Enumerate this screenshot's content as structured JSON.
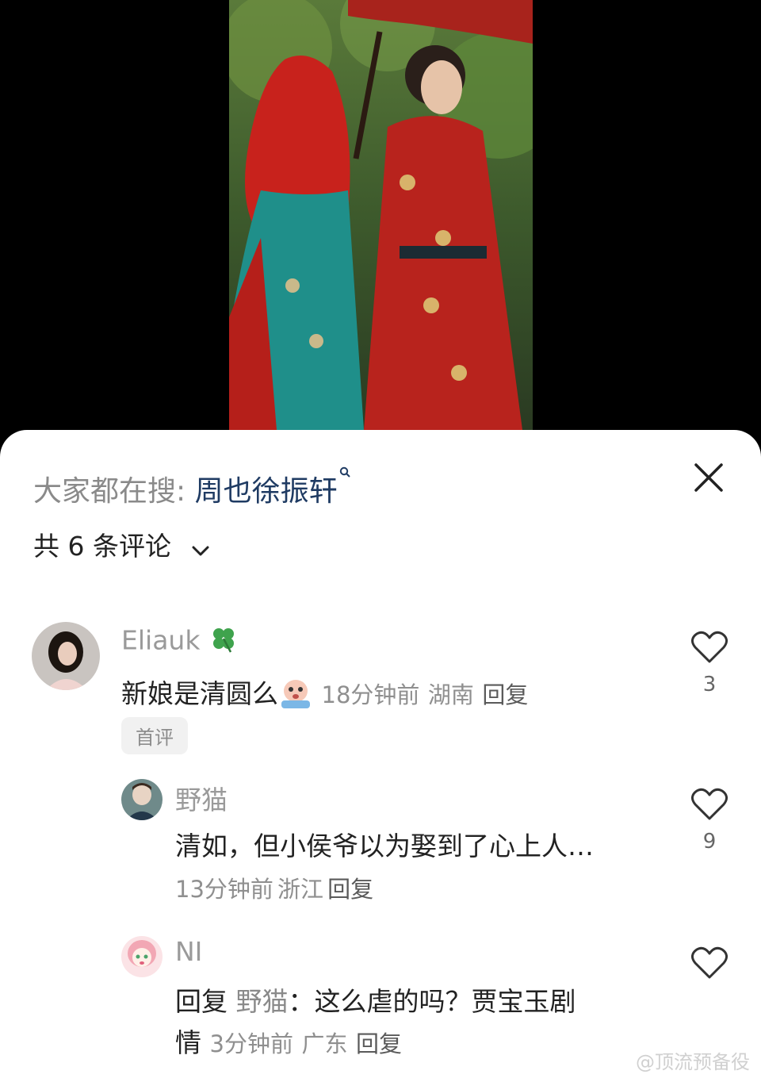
{
  "search": {
    "prefix": "大家都在搜",
    "separator": ":",
    "term": "周也徐振轩"
  },
  "comments_header": {
    "count_label": "共 6 条评论"
  },
  "comments": [
    {
      "user": "Eliauk",
      "text": "新娘是清圆么",
      "time": "18分钟前",
      "location": "湖南",
      "reply_label": "回复",
      "badge": "首评",
      "likes": "3"
    },
    {
      "user": "野猫",
      "text": "清如，但小侯爷以为娶到了心上人…",
      "time": "13分钟前",
      "location": "浙江",
      "reply_label": "回复",
      "likes": "9"
    },
    {
      "user": "NI",
      "reply_prefix": "回复",
      "reply_to": "野猫",
      "text_line1": "：这么虐的吗？贾宝玉剧",
      "text_line2": "情",
      "time": "3分钟前",
      "location": "广东",
      "reply_label": "回复",
      "likes": ""
    }
  ],
  "watermark": "@顶流预备役",
  "icons": {
    "close": "close-icon",
    "chevron": "chevron-down-icon",
    "like": "heart-icon",
    "search": "search-icon"
  },
  "colors": {
    "search_term": "#1f3b63",
    "muted_text": "#8f8f8f",
    "sheet_bg": "#ffffff"
  }
}
